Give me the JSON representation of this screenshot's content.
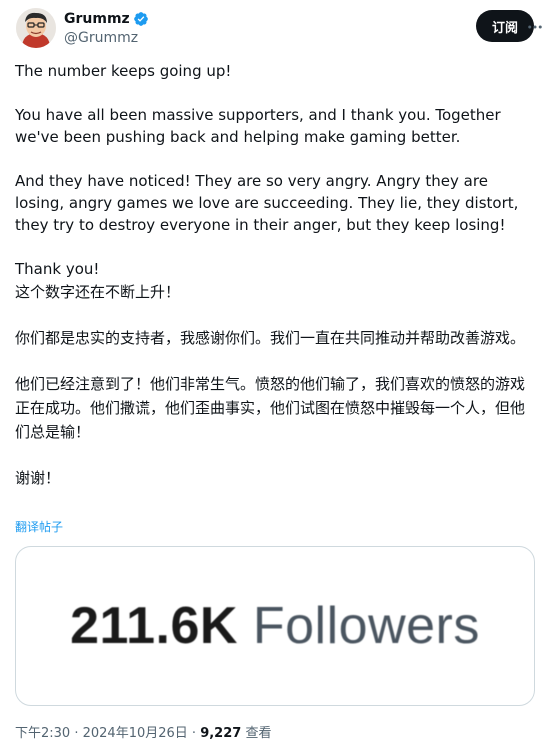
{
  "author": {
    "display_name": "Grummz",
    "handle": "@Grummz",
    "verified": true,
    "avatar_icon": "cartoon-face-avatar"
  },
  "header": {
    "subscribe_label": "订阅"
  },
  "tweet": {
    "en_paragraphs": [
      "The number keeps going up!",
      "You have all been massive supporters, and I thank you. Together we've been pushing back and helping make gaming better.",
      "And they have noticed! They are so very angry. Angry they are losing, angry games we love are succeeding. They lie, they distort, they try to destroy everyone in their anger, but they keep losing!",
      "Thank you!"
    ],
    "zh_paragraphs": [
      "这个数字还在不断上升！",
      "你们都是忠实的支持者，我感谢你们。我们一直在共同推动并帮助改善游戏。",
      "他们已经注意到了！他们非常生气。愤怒的他们输了，我们喜欢的愤怒的游戏正在成功。他们撒谎，他们歪曲事实，他们试图在愤怒中摧毁每一个人，但他们总是输！",
      "谢谢！"
    ],
    "translate_label": "翻译帖子"
  },
  "media": {
    "count": "211.6K",
    "label": "Followers"
  },
  "meta": {
    "time": "下午2:30",
    "separator": " · ",
    "date": "2024年10月26日",
    "views_count": "9,227",
    "views_label": "查看"
  },
  "colors": {
    "link": "#1d9bf0",
    "verified": "#1d9bf0",
    "text_primary": "#0f1419",
    "text_secondary": "#536471",
    "button_bg": "#0f1419"
  }
}
